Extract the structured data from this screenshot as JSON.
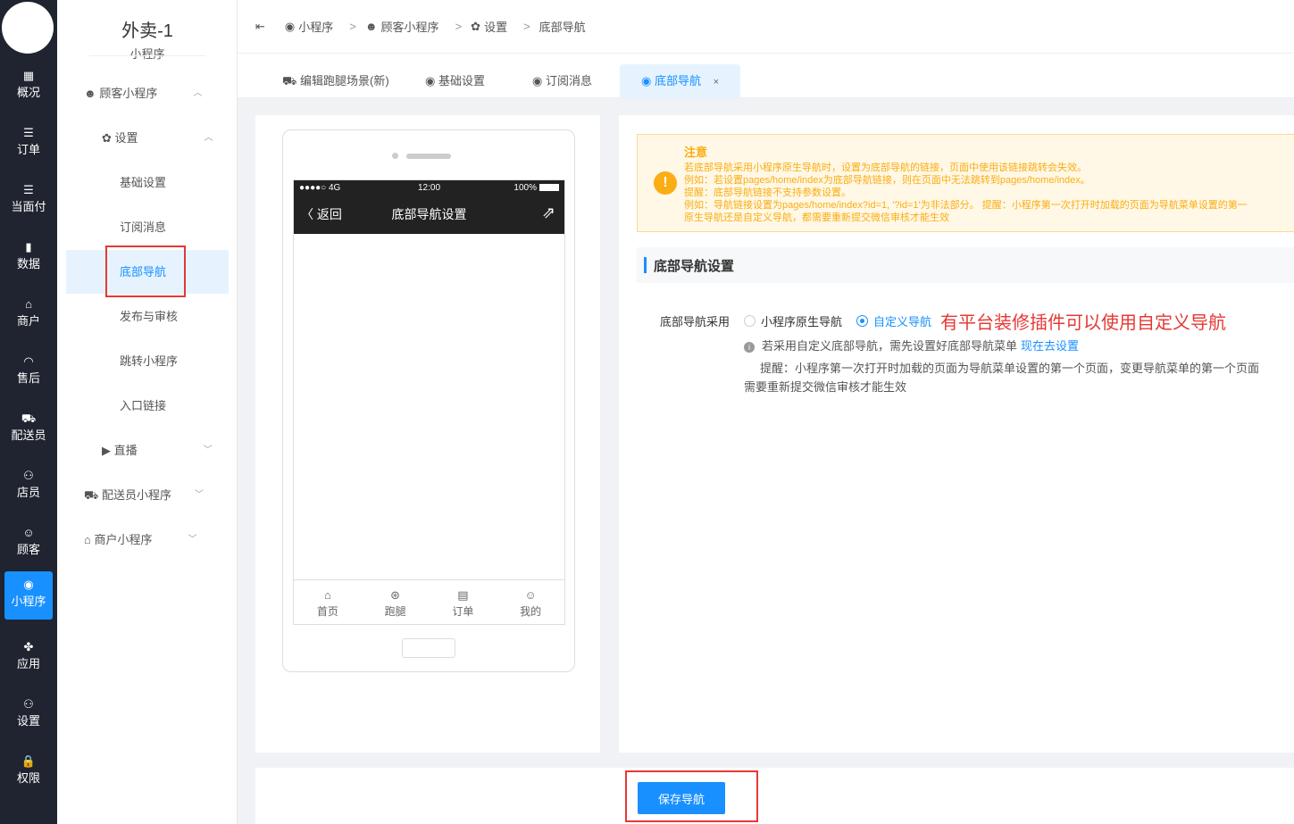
{
  "rail": {
    "items": [
      {
        "icon": "▦",
        "label": "概况"
      },
      {
        "icon": "☰",
        "label": "订单"
      },
      {
        "icon": "☰",
        "label": "当面付"
      },
      {
        "icon": "▮",
        "label": "数据"
      },
      {
        "icon": "⌂",
        "label": "商户"
      },
      {
        "icon": "◠",
        "label": "售后"
      },
      {
        "icon": "⛟",
        "label": "配送员"
      },
      {
        "icon": "⚇",
        "label": "店员"
      },
      {
        "icon": "☺",
        "label": "顾客"
      },
      {
        "icon": "◉",
        "label": "小程序"
      },
      {
        "icon": "✤",
        "label": "应用"
      },
      {
        "icon": "⚇",
        "label": "设置"
      },
      {
        "icon": "🔒",
        "label": "权限"
      }
    ]
  },
  "sidebar": {
    "title": "外卖-1",
    "subtitle": "小程序",
    "items": [
      {
        "icon": "☻",
        "label": "顾客小程序"
      },
      {
        "icon": "✿",
        "label": "设置"
      },
      {
        "label": "基础设置"
      },
      {
        "label": "订阅消息"
      },
      {
        "label": "底部导航"
      },
      {
        "label": "发布与审核"
      },
      {
        "label": "跳转小程序"
      },
      {
        "label": "入口链接"
      },
      {
        "icon": "▶",
        "label": "直播"
      },
      {
        "icon": "⛟",
        "label": "配送员小程序"
      },
      {
        "icon": "⌂",
        "label": "商户小程序"
      }
    ]
  },
  "breadcrumb": {
    "toggle": "⇤",
    "items": [
      "小程序",
      "顾客小程序",
      "设置",
      "底部导航"
    ],
    "sep": ">"
  },
  "tabs": [
    {
      "label": "编辑跑腿场景(新)"
    },
    {
      "label": "基础设置"
    },
    {
      "label": "订阅消息"
    },
    {
      "label": "底部导航",
      "close": "×"
    }
  ],
  "phone": {
    "signal": "●●●●○ 4G",
    "time": "12:00",
    "battery": "100%",
    "back": "〈 返回",
    "title": "底部导航设置",
    "share": "⇗",
    "nav": [
      {
        "icon": "⌂",
        "label": "首页"
      },
      {
        "icon": "⊛",
        "label": "跑腿"
      },
      {
        "icon": "▤",
        "label": "订单"
      },
      {
        "icon": "☺",
        "label": "我的"
      }
    ]
  },
  "notice": {
    "title": "注意",
    "lines": [
      "若底部导航采用小程序原生导航时，设置为底部导航的链接，页面中使用该链接跳转会失效。",
      "例如：若设置pages/home/index为底部导航链接，则在页面中无法跳转到pages/home/index。",
      "提醒：底部导航链接不支持参数设置。",
      "例如：导航链接设置为pages/home/index?id=1, '?id=1'为非法部分。 提醒：小程序第一次打开时加载的页面为导航菜单设置的第一",
      "原生导航还是自定义导航，都需要重新提交微信审核才能生效"
    ]
  },
  "section": {
    "title": "底部导航设置",
    "field_label": "底部导航采用",
    "option_native": "小程序原生导航",
    "option_custom": "自定义导航",
    "annotation": "有平台装修插件可以使用自定义导航",
    "hint": "若采用自定义底部导航，需先设置好底部导航菜单",
    "hint_link": "现在去设置",
    "tip_line1": "提醒：小程序第一次打开时加载的页面为导航菜单设置的第一个页面，变更导航菜单的第一个页面",
    "tip_line2": "需要重新提交微信审核才能生效"
  },
  "save_label": "保存导航"
}
